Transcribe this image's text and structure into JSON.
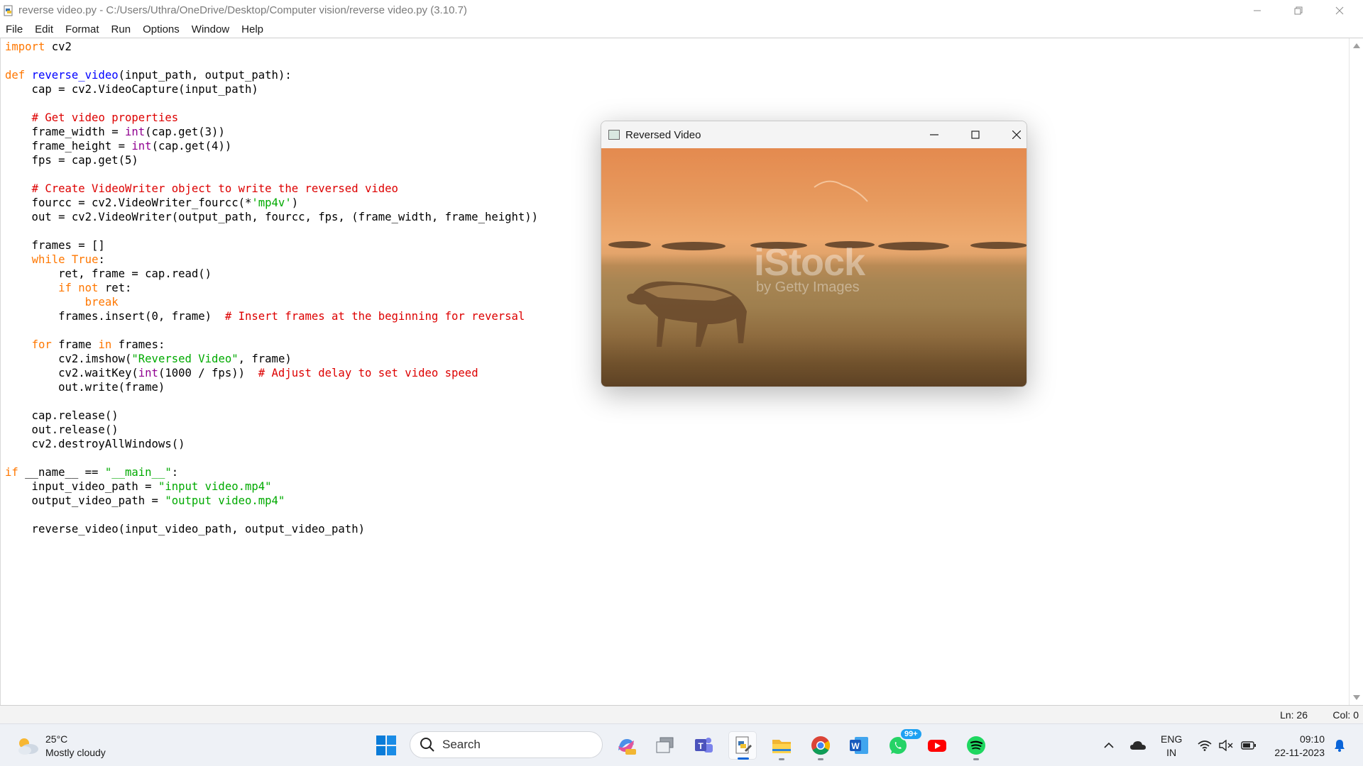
{
  "window": {
    "title": "reverse video.py - C:/Users/Uthra/OneDrive/Desktop/Computer vision/reverse video.py (3.10.7)"
  },
  "menu": [
    "File",
    "Edit",
    "Format",
    "Run",
    "Options",
    "Window",
    "Help"
  ],
  "editor": {
    "lines": [
      [
        {
          "t": "import",
          "c": "kw"
        },
        {
          "t": " cv2"
        }
      ],
      [],
      [
        {
          "t": "def",
          "c": "kw"
        },
        {
          "t": " "
        },
        {
          "t": "reverse_video",
          "c": "def"
        },
        {
          "t": "(input_path, output_path):"
        }
      ],
      [
        {
          "t": "    cap = cv2.VideoCapture(input_path)"
        }
      ],
      [],
      [
        {
          "t": "    "
        },
        {
          "t": "# Get video properties",
          "c": "cm"
        }
      ],
      [
        {
          "t": "    frame_width = "
        },
        {
          "t": "int",
          "c": "bi"
        },
        {
          "t": "(cap.get(3))"
        }
      ],
      [
        {
          "t": "    frame_height = "
        },
        {
          "t": "int",
          "c": "bi"
        },
        {
          "t": "(cap.get(4))"
        }
      ],
      [
        {
          "t": "    fps = cap.get(5)"
        }
      ],
      [],
      [
        {
          "t": "    "
        },
        {
          "t": "# Create VideoWriter object to write the reversed video",
          "c": "cm"
        }
      ],
      [
        {
          "t": "    fourcc = cv2.VideoWriter_fourcc(*"
        },
        {
          "t": "'mp4v'",
          "c": "st"
        },
        {
          "t": ")"
        }
      ],
      [
        {
          "t": "    out = cv2.VideoWriter(output_path, fourcc, fps, (frame_width, frame_height))"
        }
      ],
      [],
      [
        {
          "t": "    frames = []"
        }
      ],
      [
        {
          "t": "    "
        },
        {
          "t": "while",
          "c": "kw"
        },
        {
          "t": " "
        },
        {
          "t": "True",
          "c": "kw"
        },
        {
          "t": ":"
        }
      ],
      [
        {
          "t": "        ret, frame = cap.read()"
        }
      ],
      [
        {
          "t": "        "
        },
        {
          "t": "if",
          "c": "kw"
        },
        {
          "t": " "
        },
        {
          "t": "not",
          "c": "kw"
        },
        {
          "t": " ret:"
        }
      ],
      [
        {
          "t": "            "
        },
        {
          "t": "break",
          "c": "kw"
        }
      ],
      [
        {
          "t": "        frames.insert(0, frame)  "
        },
        {
          "t": "# Insert frames at the beginning for reversal",
          "c": "cm"
        }
      ],
      [],
      [
        {
          "t": "    "
        },
        {
          "t": "for",
          "c": "kw"
        },
        {
          "t": " frame "
        },
        {
          "t": "in",
          "c": "kw"
        },
        {
          "t": " frames:"
        }
      ],
      [
        {
          "t": "        cv2.imshow("
        },
        {
          "t": "\"Reversed Video\"",
          "c": "st"
        },
        {
          "t": ", frame)"
        }
      ],
      [
        {
          "t": "        cv2.waitKey("
        },
        {
          "t": "int",
          "c": "bi"
        },
        {
          "t": "(1000 / fps))  "
        },
        {
          "t": "# Adjust delay to set video speed",
          "c": "cm"
        }
      ],
      [
        {
          "t": "        out.write(frame)"
        }
      ],
      [],
      [
        {
          "t": "    cap.release()"
        }
      ],
      [
        {
          "t": "    out.release()"
        }
      ],
      [
        {
          "t": "    cv2.destroyAllWindows()"
        }
      ],
      [],
      [
        {
          "t": "if",
          "c": "kw"
        },
        {
          "t": " __name__ == "
        },
        {
          "t": "\"__main__\"",
          "c": "st"
        },
        {
          "t": ":"
        }
      ],
      [
        {
          "t": "    input_video_path = "
        },
        {
          "t": "\"input video.mp4\"",
          "c": "st"
        }
      ],
      [
        {
          "t": "    output_video_path = "
        },
        {
          "t": "\"output video.mp4\"",
          "c": "st"
        }
      ],
      [],
      [
        {
          "t": "    reverse_video(input_video_path, output_video_path)"
        }
      ]
    ]
  },
  "statusbar": {
    "line": "Ln: 26",
    "col": "Col: 0"
  },
  "video_window": {
    "title": "Reversed Video",
    "watermark": "iStock",
    "watermark_sub": "by Getty Images"
  },
  "taskbar": {
    "weather_temp": "25°C",
    "weather_desc": "Mostly cloudy",
    "search_label": "Search",
    "whatsapp_badge": "99+",
    "lang_top": "ENG",
    "lang_bottom": "IN",
    "time": "09:10",
    "date": "22-11-2023"
  },
  "colors": {
    "keyword": "#ff7700",
    "definition": "#0000ff",
    "comment": "#dd0000",
    "string": "#00aa00",
    "builtin": "#900090",
    "taskbar_accent": "#0a64d8"
  }
}
